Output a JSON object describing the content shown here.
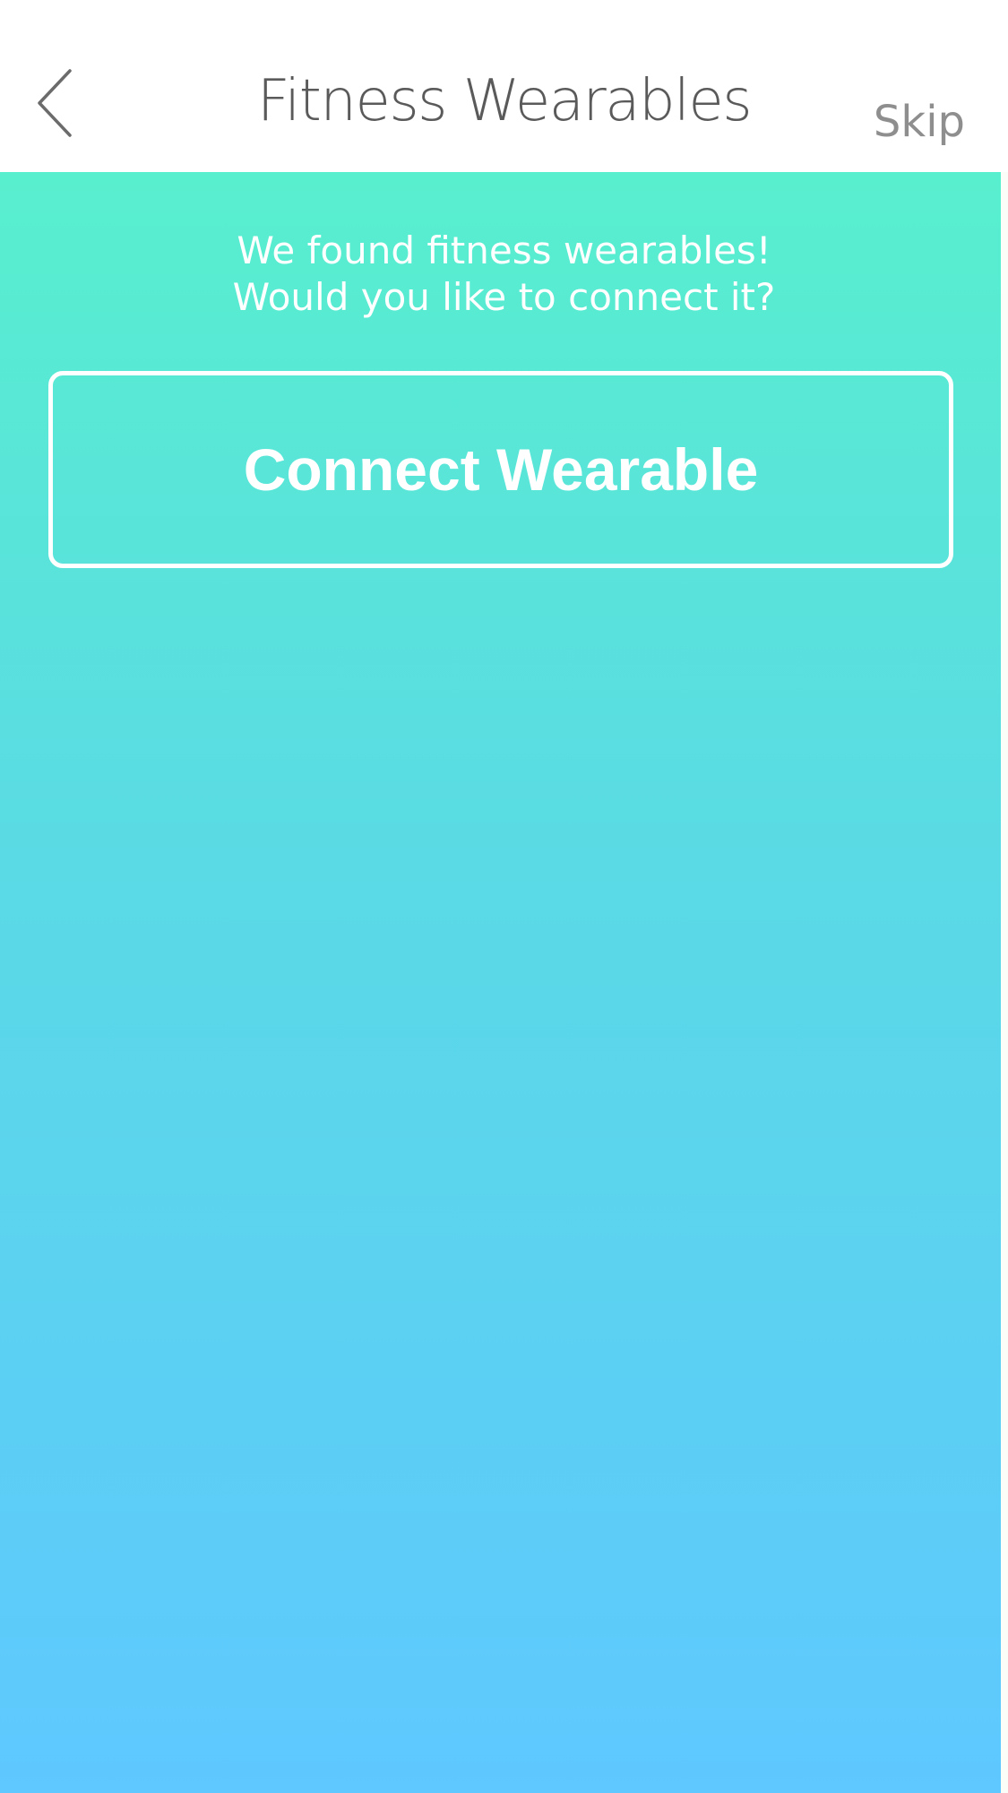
{
  "nav": {
    "title": "Fitness Wearables",
    "skip_label": "Skip",
    "back_icon": "chevron-left-icon"
  },
  "content": {
    "message_line1": "We found fitness wearables!",
    "message_line2": "Would you like to connect it?",
    "connect_label": "Connect Wearable"
  },
  "colors": {
    "gradient_top": "#58efce",
    "gradient_bottom": "#5ec8ff",
    "title_text": "#5a5a5a",
    "skip_text": "#8e8e8e"
  }
}
